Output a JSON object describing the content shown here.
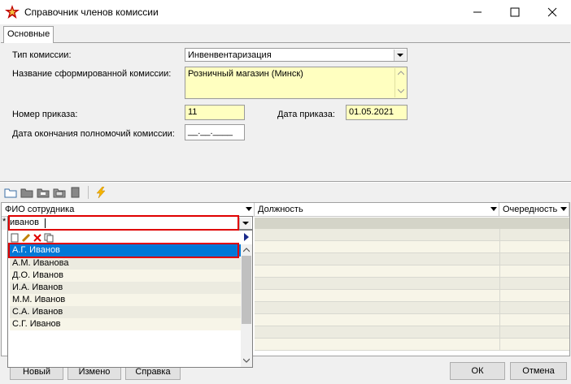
{
  "window": {
    "title": "Справочник членов комиссии"
  },
  "tabs": [
    {
      "label": "Основные"
    }
  ],
  "form": {
    "commission_type_label": "Тип комиссии:",
    "commission_type_value": "Инвенвентаризация",
    "commission_name_label": "Название сформированной комиссии:",
    "commission_name_value": "Розничный магазин (Минск)",
    "order_number_label": "Номер приказа:",
    "order_number_value": "11",
    "order_date_label": "Дата приказа:",
    "order_date_value": "01.05.2021",
    "end_date_label": "Дата окончания полномочий комиссии:",
    "end_date_value": "__.__.____"
  },
  "grid": {
    "columns": [
      "ФИО сотрудника",
      "Должность",
      "Очередность"
    ],
    "row_marker": "*",
    "edit_value": "иванов"
  },
  "dropdown": {
    "items": [
      "А.Г. Иванов",
      "А.М. Иванова",
      "Д.О. Иванов",
      "И.А. Иванов",
      "М.М. Иванов",
      "С.А. Иванов",
      "С.Г. Иванов"
    ],
    "selected_index": 0
  },
  "buttons": {
    "new_label": "Новый",
    "change_label": "Измено",
    "help_label": "Справка",
    "ok_label": "ОК",
    "cancel_label": "Отмена"
  },
  "colors": {
    "field_yellow": "#ffffc0",
    "selection_blue": "#0078d7",
    "highlight_red": "#e00000"
  }
}
